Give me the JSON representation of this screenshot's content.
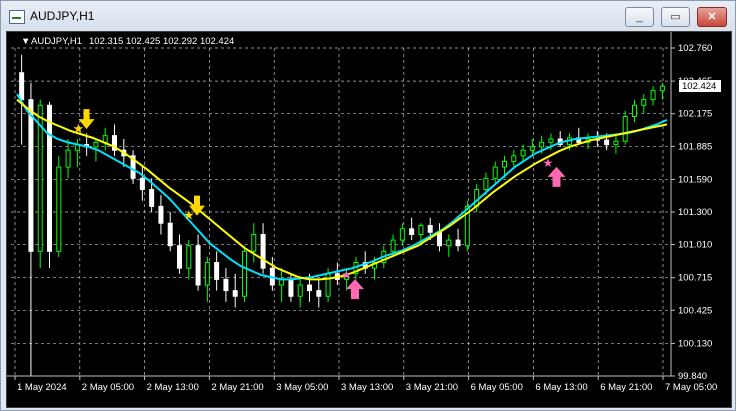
{
  "window": {
    "title": "AUDJPY,H1",
    "min_glyph": "_",
    "max_glyph": "▭",
    "close_glyph": "✕"
  },
  "chart": {
    "header_symbol": "AUDJPY,H1",
    "header_ohlc": "102.315 102.425 102.292 102.424",
    "current_price_label": "102.424"
  },
  "colors": {
    "background": "#000000",
    "grid": "#c0c0c0",
    "bull_candle": "#00ff00",
    "bear_candle": "#ffffff",
    "ma_fast": "#00e0ff",
    "ma_slow": "#ffff00",
    "sell_signal": "#ffd700",
    "buy_signal": "#ff69b4"
  },
  "chart_data": {
    "type": "candlestick",
    "y_ticks": [
      "102.760",
      "102.465",
      "102.175",
      "101.885",
      "101.590",
      "101.300",
      "101.010",
      "100.715",
      "100.425",
      "100.130",
      "99.840"
    ],
    "x_ticks": [
      "1 May 2024",
      "2 May 05:00",
      "2 May 13:00",
      "2 May 21:00",
      "3 May 05:00",
      "3 May 13:00",
      "3 May 21:00",
      "6 May 05:00",
      "6 May 13:00",
      "6 May 21:00",
      "7 May 05:00"
    ],
    "ylim": [
      99.84,
      102.76
    ],
    "candles": [
      [
        102.54,
        102.7,
        101.9,
        102.3
      ],
      [
        102.3,
        102.45,
        99.84,
        100.95
      ],
      [
        100.95,
        102.3,
        100.8,
        102.25
      ],
      [
        102.25,
        102.28,
        100.8,
        100.95
      ],
      [
        100.95,
        101.8,
        100.9,
        101.7
      ],
      [
        101.7,
        101.95,
        101.6,
        101.85
      ],
      [
        101.85,
        101.95,
        101.7,
        101.9
      ],
      [
        101.9,
        102.0,
        101.8,
        101.88
      ],
      [
        101.88,
        101.95,
        101.75,
        101.92
      ],
      [
        101.92,
        102.05,
        101.85,
        101.98
      ],
      [
        101.98,
        102.08,
        101.8,
        101.85
      ],
      [
        101.85,
        101.95,
        101.7,
        101.8
      ],
      [
        101.8,
        101.85,
        101.55,
        101.6
      ],
      [
        101.6,
        101.7,
        101.4,
        101.5
      ],
      [
        101.5,
        101.6,
        101.3,
        101.35
      ],
      [
        101.35,
        101.45,
        101.1,
        101.2
      ],
      [
        101.2,
        101.3,
        100.95,
        101.0
      ],
      [
        101.0,
        101.1,
        100.75,
        100.8
      ],
      [
        100.8,
        101.05,
        100.7,
        101.0
      ],
      [
        101.0,
        101.1,
        100.6,
        100.65
      ],
      [
        100.65,
        100.9,
        100.5,
        100.85
      ],
      [
        100.85,
        100.95,
        100.6,
        100.7
      ],
      [
        100.7,
        100.8,
        100.5,
        100.6
      ],
      [
        100.6,
        100.75,
        100.45,
        100.55
      ],
      [
        100.55,
        101.0,
        100.5,
        100.95
      ],
      [
        100.95,
        101.2,
        100.85,
        101.1
      ],
      [
        101.1,
        101.2,
        100.75,
        100.8
      ],
      [
        100.8,
        100.9,
        100.6,
        100.65
      ],
      [
        100.65,
        100.8,
        100.5,
        100.7
      ],
      [
        100.7,
        100.75,
        100.5,
        100.55
      ],
      [
        100.55,
        100.7,
        100.45,
        100.65
      ],
      [
        100.65,
        100.75,
        100.5,
        100.6
      ],
      [
        100.6,
        100.7,
        100.45,
        100.55
      ],
      [
        100.55,
        100.8,
        100.5,
        100.75
      ],
      [
        100.75,
        100.85,
        100.65,
        100.7
      ],
      [
        100.7,
        100.8,
        100.6,
        100.75
      ],
      [
        100.75,
        100.9,
        100.7,
        100.85
      ],
      [
        100.85,
        100.95,
        100.75,
        100.8
      ],
      [
        100.8,
        100.9,
        100.7,
        100.85
      ],
      [
        100.85,
        101.0,
        100.8,
        100.95
      ],
      [
        100.95,
        101.1,
        100.9,
        101.05
      ],
      [
        101.05,
        101.2,
        101.0,
        101.15
      ],
      [
        101.15,
        101.25,
        101.05,
        101.1
      ],
      [
        101.1,
        101.2,
        101.0,
        101.18
      ],
      [
        101.18,
        101.25,
        101.05,
        101.12
      ],
      [
        101.12,
        101.2,
        100.95,
        101.0
      ],
      [
        101.0,
        101.1,
        100.9,
        101.05
      ],
      [
        101.05,
        101.15,
        100.95,
        101.0
      ],
      [
        101.0,
        101.4,
        100.95,
        101.35
      ],
      [
        101.35,
        101.55,
        101.3,
        101.5
      ],
      [
        101.5,
        101.65,
        101.45,
        101.6
      ],
      [
        101.6,
        101.75,
        101.55,
        101.7
      ],
      [
        101.7,
        101.8,
        101.6,
        101.75
      ],
      [
        101.75,
        101.85,
        101.7,
        101.8
      ],
      [
        101.8,
        101.9,
        101.75,
        101.85
      ],
      [
        101.85,
        101.95,
        101.8,
        101.88
      ],
      [
        101.88,
        101.98,
        101.82,
        101.92
      ],
      [
        101.92,
        102.0,
        101.85,
        101.95
      ],
      [
        101.95,
        102.02,
        101.88,
        101.9
      ],
      [
        101.9,
        102.0,
        101.85,
        101.96
      ],
      [
        101.96,
        102.05,
        101.9,
        101.92
      ],
      [
        101.92,
        102.0,
        101.86,
        101.95
      ],
      [
        101.95,
        102.02,
        101.88,
        101.94
      ],
      [
        101.94,
        102.0,
        101.85,
        101.9
      ],
      [
        101.9,
        101.98,
        101.82,
        101.93
      ],
      [
        101.93,
        102.2,
        101.9,
        102.15
      ],
      [
        102.15,
        102.3,
        102.1,
        102.25
      ],
      [
        102.25,
        102.35,
        102.18,
        102.3
      ],
      [
        102.3,
        102.42,
        102.25,
        102.38
      ],
      [
        102.38,
        102.45,
        102.3,
        102.42
      ]
    ],
    "series": [
      {
        "name": "",
        "kind": "ma_fast",
        "values": [
          102.35,
          102.2,
          102.1,
          102.0,
          101.95,
          101.92,
          101.9,
          101.88,
          101.85,
          101.8,
          101.75,
          101.7,
          101.65,
          101.58,
          101.5,
          101.42,
          101.32,
          101.22,
          101.12,
          101.02,
          100.95,
          100.88,
          100.82,
          100.78,
          100.74,
          100.72,
          100.7,
          100.7,
          100.71,
          100.72,
          100.74,
          100.76,
          100.78,
          100.8,
          100.83,
          100.86,
          100.9,
          100.93,
          100.96,
          101.0,
          101.05,
          101.1,
          101.15,
          101.22,
          101.3,
          101.38,
          101.46,
          101.54,
          101.62,
          101.7,
          101.76,
          101.82,
          101.86,
          101.9,
          101.93,
          101.95,
          101.96,
          101.97,
          101.98,
          101.99,
          102.0,
          102.02,
          102.05,
          102.08,
          102.12
        ]
      },
      {
        "name": "",
        "kind": "ma_slow",
        "values": [
          102.3,
          102.22,
          102.15,
          102.1,
          102.06,
          102.02,
          101.99,
          101.96,
          101.92,
          101.88,
          101.82,
          101.75,
          101.68,
          101.6,
          101.52,
          101.45,
          101.38,
          101.3,
          101.22,
          101.14,
          101.06,
          100.98,
          100.92,
          100.86,
          100.8,
          100.76,
          100.72,
          100.7,
          100.7,
          100.71,
          100.73,
          100.76,
          100.8,
          100.84,
          100.88,
          100.92,
          100.96,
          101.0,
          101.06,
          101.12,
          101.18,
          101.25,
          101.32,
          101.4,
          101.48,
          101.55,
          101.62,
          101.68,
          101.74,
          101.79,
          101.84,
          101.88,
          101.91,
          101.94,
          101.96,
          101.98,
          102.0,
          102.02,
          102.04,
          102.06,
          102.08
        ]
      }
    ],
    "signals": [
      {
        "kind": "sell",
        "candle": 11,
        "price": 102.02
      },
      {
        "kind": "sell",
        "candle": 28,
        "price": 101.25
      },
      {
        "kind": "buy",
        "candle": 52,
        "price": 100.72
      },
      {
        "kind": "buy",
        "candle": 83,
        "price": 101.72
      }
    ]
  }
}
